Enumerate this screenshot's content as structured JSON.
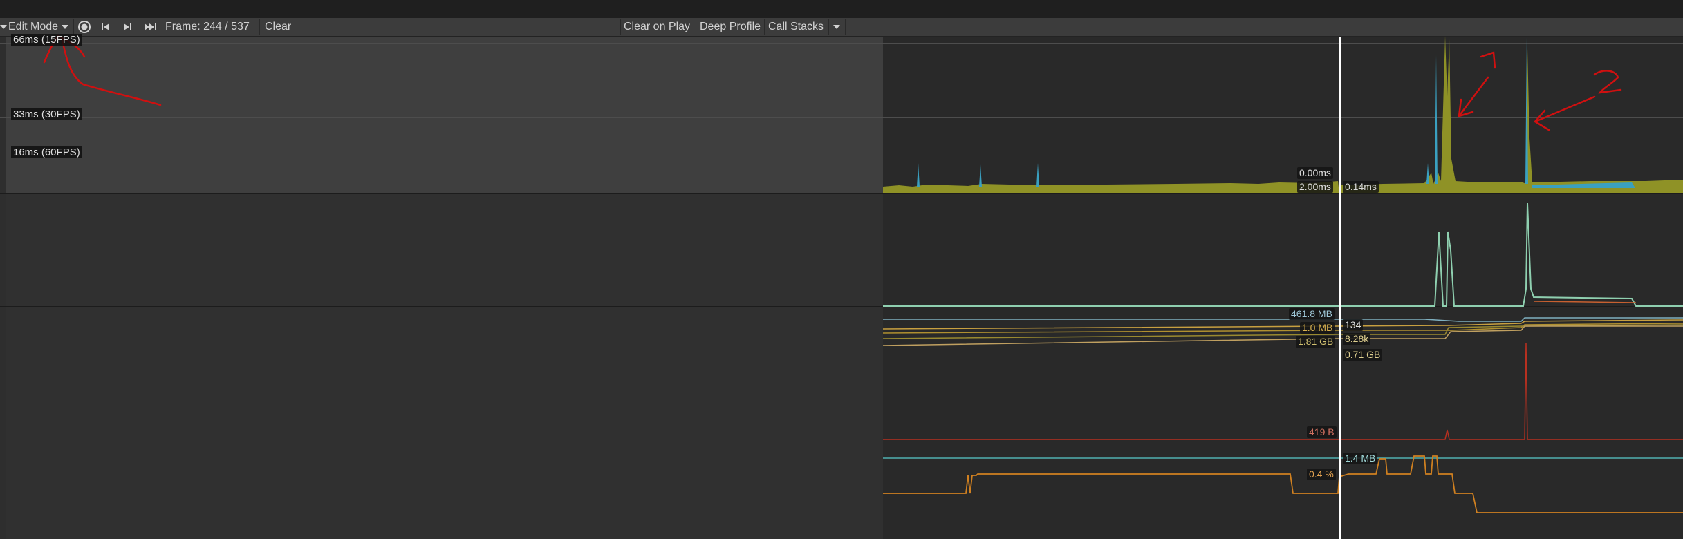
{
  "toolbar": {
    "mode_label": "Edit Mode",
    "frame_label": "Frame: 244 / 537",
    "clear_label": "Clear",
    "clear_on_play_label": "Clear on Play",
    "deep_profile_label": "Deep Profile",
    "call_stacks_label": "Call Stacks"
  },
  "cpu_axis": {
    "line_66": "66ms (15FPS)",
    "line_33": "33ms (30FPS)",
    "line_16": "16ms (60FPS)"
  },
  "cpu_readouts": {
    "left_top": "0.00ms",
    "left_bottom": "2.00ms",
    "right": "0.14ms"
  },
  "memory_readouts": {
    "left_1": "461.8 MB",
    "left_2": "1.0 MB",
    "left_3": "1.81 GB",
    "right_1": "134",
    "right_2": "8.28k",
    "right_3": "0.71 GB"
  },
  "audio_readouts": {
    "left": "419 B"
  },
  "bottom_readouts": {
    "right": "1.4 MB",
    "left": "0.4 %"
  },
  "colors": {
    "cpu_scripts": "#9a9a2a",
    "cpu_rendering": "#3aa0c0",
    "render_line": "#8fd0b0",
    "memory_a": "#7fb0c0",
    "memory_b": "#c8a040",
    "memory_c": "#b09030",
    "audio_line": "#b83020",
    "bottom_teal": "#50b0b0",
    "bottom_orange": "#d08020",
    "annotation_red": "#d01010",
    "selection_line": "#ffffff"
  }
}
